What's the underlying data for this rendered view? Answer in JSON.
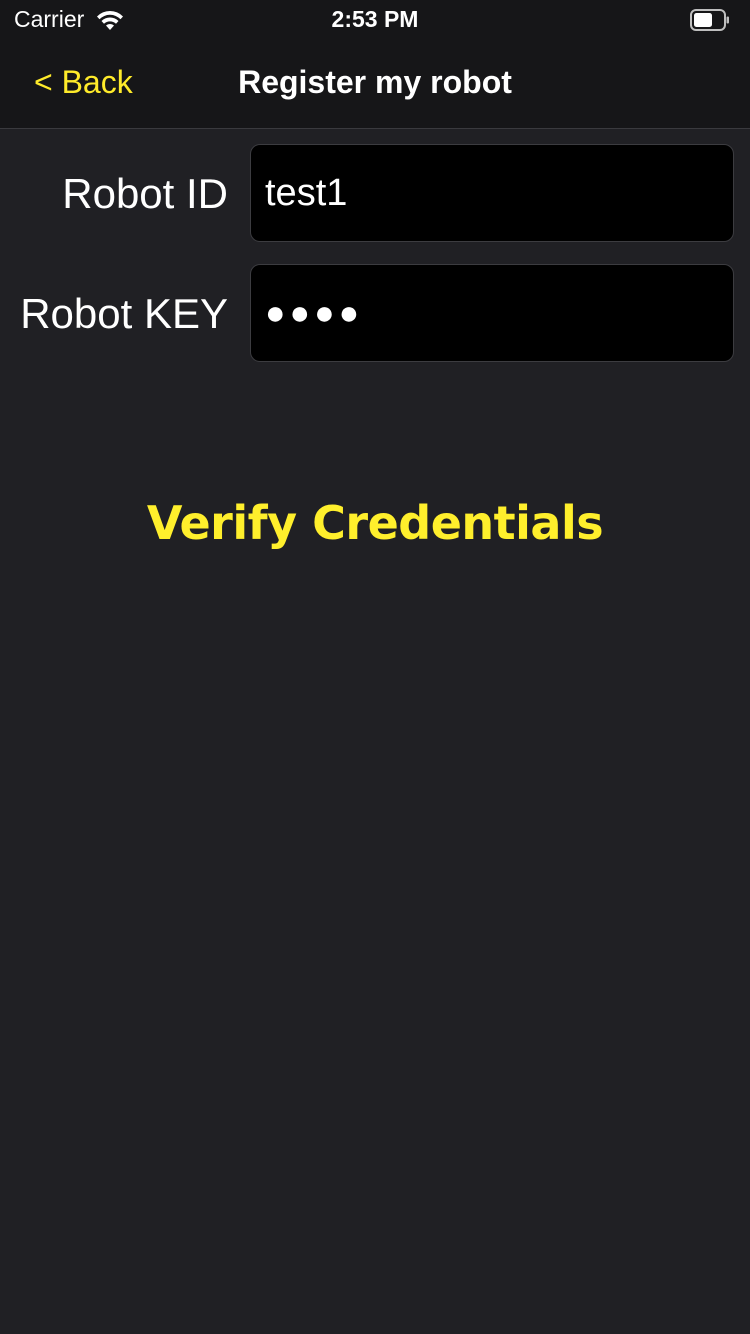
{
  "status_bar": {
    "carrier": "Carrier",
    "time": "2:53 PM",
    "wifi_icon": "wifi-icon",
    "battery_icon": "battery-icon"
  },
  "nav": {
    "back_label": "< Back",
    "title": "Register my robot"
  },
  "form": {
    "robot_id_label": "Robot ID",
    "robot_id_value": "test1",
    "robot_key_label": "Robot KEY",
    "robot_key_value": "●●●●"
  },
  "actions": {
    "verify_label": "Verify Credentials"
  },
  "colors": {
    "accent": "#ffeb2a",
    "background": "#202024",
    "bar_background": "#161618",
    "input_background": "#000000"
  }
}
